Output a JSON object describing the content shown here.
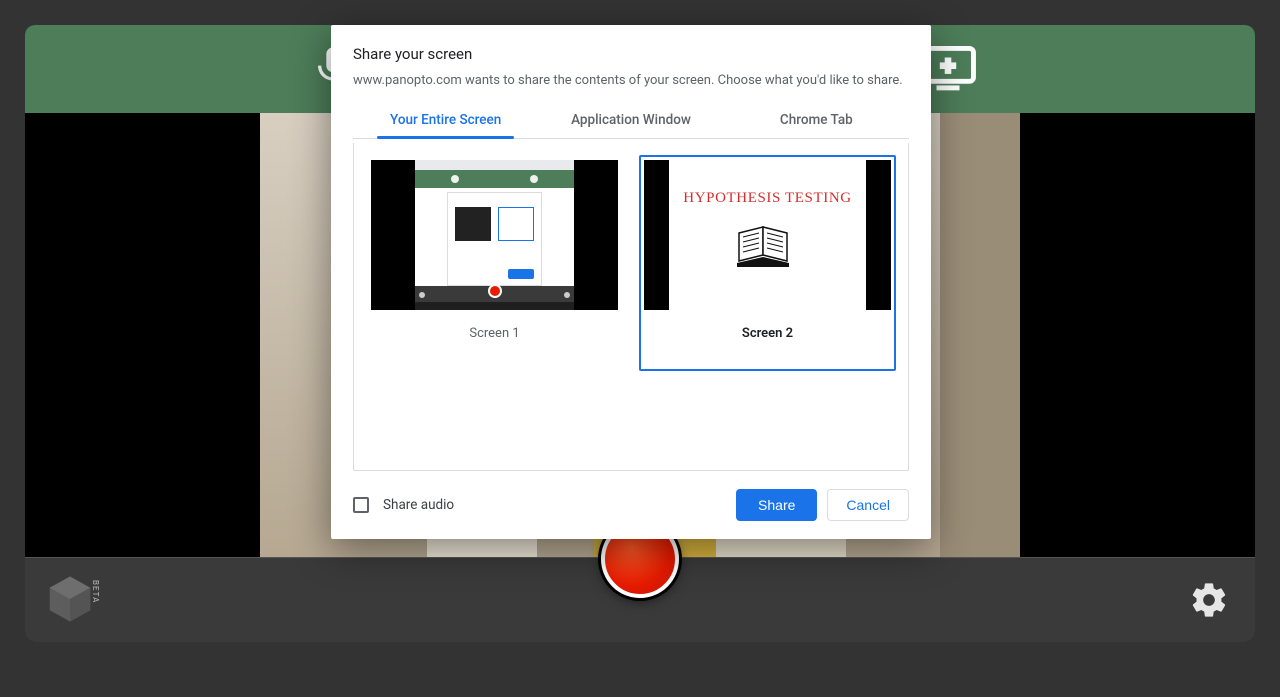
{
  "dialog": {
    "title": "Share your screen",
    "description": "www.panopto.com wants to share the contents of your screen. Choose what you'd like to share.",
    "tabs": [
      {
        "label": "Your Entire Screen",
        "active": true
      },
      {
        "label": "Application Window",
        "active": false
      },
      {
        "label": "Chrome Tab",
        "active": false
      }
    ],
    "screens": [
      {
        "label": "Screen 1",
        "selected": false,
        "slide_title": ""
      },
      {
        "label": "Screen 2",
        "selected": true,
        "slide_title": "HYPOTHESIS TESTING"
      }
    ],
    "share_audio_label": "Share audio",
    "share_button": "Share",
    "cancel_button": "Cancel"
  },
  "bottombar": {
    "beta_label": "BETA"
  }
}
